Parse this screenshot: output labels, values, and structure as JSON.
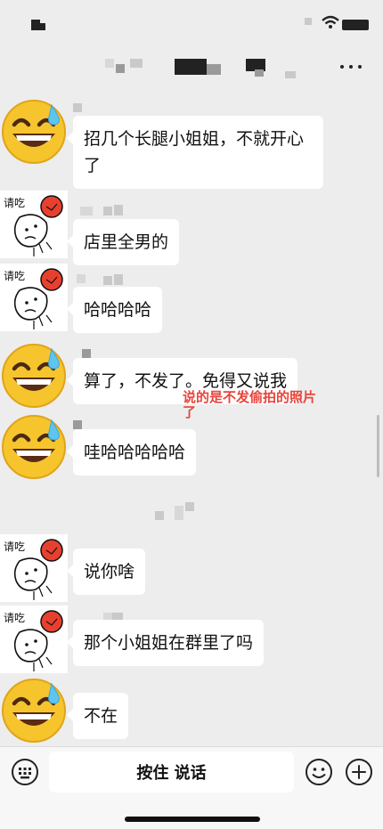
{
  "header": {
    "more_icon": "more-icon"
  },
  "messages": [
    {
      "id": 1,
      "avatar": "sweat-smile-emoji-avatar",
      "text": "招几个长腿小姐姐，不就开心了"
    },
    {
      "id": 2,
      "avatar": "boxing-sticker-avatar",
      "sticker_text": "请吃",
      "text": "店里全男的"
    },
    {
      "id": 3,
      "avatar": "boxing-sticker-avatar",
      "sticker_text": "请吃",
      "text": "哈哈哈哈"
    },
    {
      "id": 4,
      "avatar": "sweat-smile-emoji-avatar",
      "text": "算了，不发了。免得又说我"
    },
    {
      "id": 5,
      "avatar": "sweat-smile-emoji-avatar",
      "text": "哇哈哈哈哈哈"
    },
    {
      "id": 6,
      "avatar": "boxing-sticker-avatar",
      "sticker_text": "请吃",
      "text": "说你啥"
    },
    {
      "id": 7,
      "avatar": "boxing-sticker-avatar",
      "sticker_text": "请吃",
      "text": "那个小姐姐在群里了吗"
    },
    {
      "id": 8,
      "avatar": "sweat-smile-emoji-avatar",
      "text": "不在"
    }
  ],
  "annotation": {
    "line1": "说的是不发偷拍的照片",
    "line2": "了",
    "color": "#e8453c"
  },
  "input_bar": {
    "voice_keyboard_icon": "keyboard-icon",
    "hold_to_talk_label": "按住 说话",
    "emoji_icon": "emoji-icon",
    "plus_icon": "plus-icon"
  },
  "colors": {
    "background": "#ededed",
    "bubble": "#ffffff",
    "annotation": "#e8453c"
  }
}
